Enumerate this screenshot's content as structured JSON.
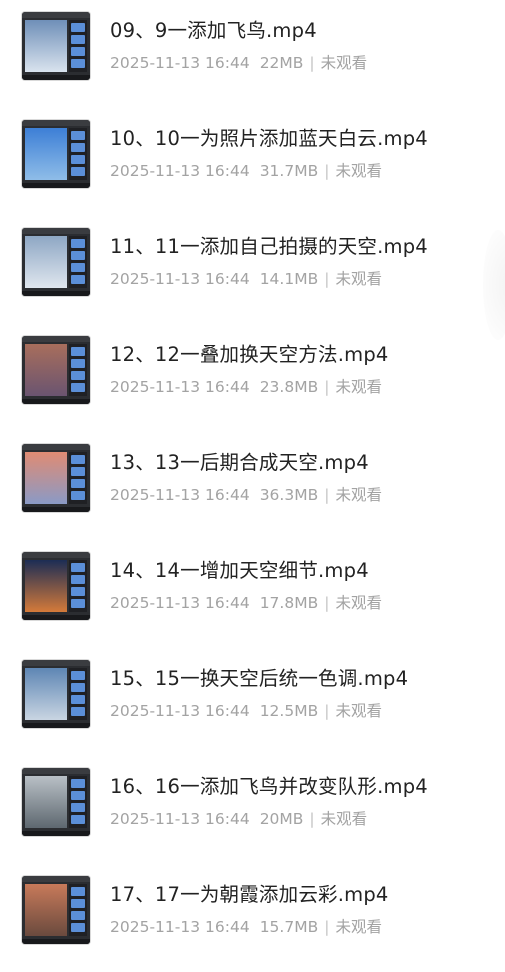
{
  "files": [
    {
      "title": "09、9一添加飞鸟.mp4",
      "date": "2025-11-13 16:44",
      "size": "22MB",
      "status": "未观看",
      "thumb_colors": [
        "#6f8fb8",
        "#d9e3ee"
      ],
      "thumb_icon": "video-thumbnail-icon"
    },
    {
      "title": "10、10一为照片添加蓝天白云.mp4",
      "date": "2025-11-13 16:44",
      "size": "31.7MB",
      "status": "未观看",
      "thumb_colors": [
        "#3d7fd6",
        "#8fbde8"
      ],
      "thumb_icon": "video-thumbnail-icon"
    },
    {
      "title": "11、11一添加自己拍摄的天空.mp4",
      "date": "2025-11-13 16:44",
      "size": "14.1MB",
      "status": "未观看",
      "thumb_colors": [
        "#8ea7c4",
        "#dfe6ee"
      ],
      "thumb_icon": "video-thumbnail-icon"
    },
    {
      "title": "12、12一叠加换天空方法.mp4",
      "date": "2025-11-13 16:44",
      "size": "23.8MB",
      "status": "未观看",
      "thumb_colors": [
        "#a86e5c",
        "#6a5470"
      ],
      "thumb_icon": "video-thumbnail-icon"
    },
    {
      "title": "13、13一后期合成天空.mp4",
      "date": "2025-11-13 16:44",
      "size": "36.3MB",
      "status": "未观看",
      "thumb_colors": [
        "#e08b73",
        "#8a9ac6"
      ],
      "thumb_icon": "video-thumbnail-icon"
    },
    {
      "title": "14、14一增加天空细节.mp4",
      "date": "2025-11-13 16:44",
      "size": "17.8MB",
      "status": "未观看",
      "thumb_colors": [
        "#1c2d55",
        "#d47a3a"
      ],
      "thumb_icon": "video-thumbnail-icon"
    },
    {
      "title": "15、15一换天空后统一色调.mp4",
      "date": "2025-11-13 16:44",
      "size": "12.5MB",
      "status": "未观看",
      "thumb_colors": [
        "#5e86b4",
        "#c9d5e2"
      ],
      "thumb_icon": "video-thumbnail-icon"
    },
    {
      "title": "16、16一添加飞鸟并改变队形.mp4",
      "date": "2025-11-13 16:44",
      "size": "20MB",
      "status": "未观看",
      "thumb_colors": [
        "#b9c0c6",
        "#5e6870"
      ],
      "thumb_icon": "video-thumbnail-icon"
    },
    {
      "title": "17、17一为朝霞添加云彩.mp4",
      "date": "2025-11-13 16:44",
      "size": "15.7MB",
      "status": "未观看",
      "thumb_colors": [
        "#c87a5a",
        "#6a4a3e"
      ],
      "thumb_icon": "video-thumbnail-icon"
    }
  ]
}
